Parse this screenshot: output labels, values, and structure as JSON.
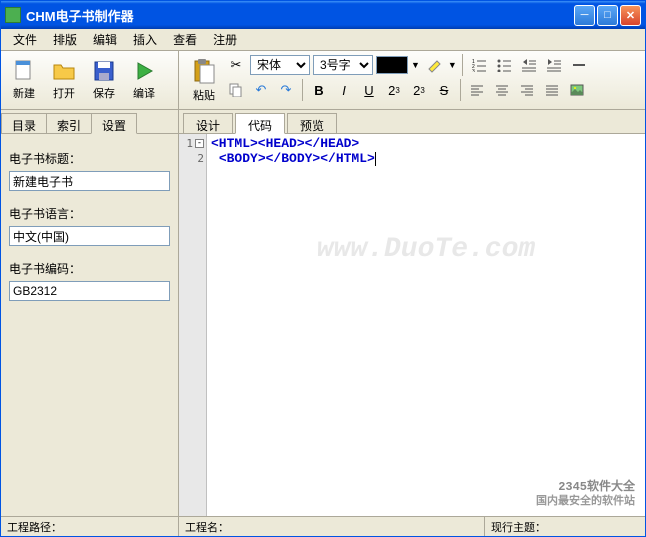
{
  "window": {
    "title": "CHM电子书制作器"
  },
  "menu": {
    "file": "文件",
    "layout": "排版",
    "edit": "编辑",
    "insert": "插入",
    "view": "查看",
    "register": "注册"
  },
  "toolbar": {
    "new": "新建",
    "open": "打开",
    "save": "保存",
    "compile": "编译",
    "paste": "粘贴",
    "font_name": "宋体",
    "font_size": "3号字"
  },
  "left_tabs": {
    "toc": "目录",
    "index": "索引",
    "settings": "设置"
  },
  "settings_form": {
    "title_label": "电子书标题：",
    "title_value": "新建电子书",
    "lang_label": "电子书语言：",
    "lang_value": "中文(中国)",
    "encoding_label": "电子书编码：",
    "encoding_value": "GB2312"
  },
  "right_tabs": {
    "design": "设计",
    "code": "代码",
    "preview": "预览"
  },
  "code": {
    "line1_num": "1",
    "line2_num": "2",
    "line1": "<HTML><HEAD></HEAD>",
    "line2": "<BODY></BODY></HTML>"
  },
  "status": {
    "path": "工程路径：",
    "name": "工程名：",
    "theme": "现行主题："
  },
  "watermark": "www.DuoTe.com",
  "wm_brand": "2345软件大全",
  "wm_sub": "国内最安全的软件站"
}
